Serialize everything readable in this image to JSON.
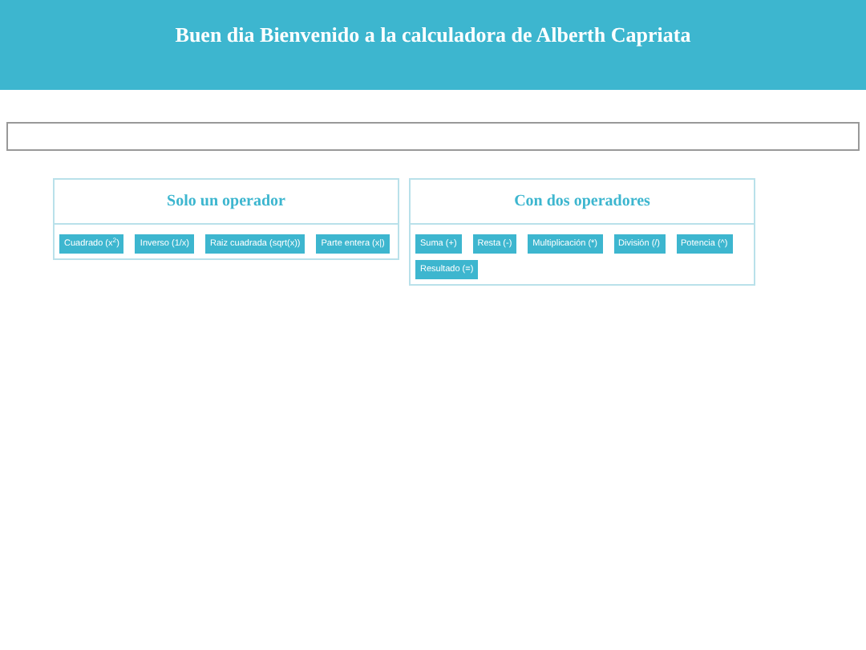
{
  "header": {
    "title": "Buen dia Bienvenido a la calculadora de Alberth Capriata"
  },
  "panels": [
    {
      "title": "Solo un operador",
      "buttons": [
        "Cuadrado (x$^{2}$)",
        "Inverso (1/x)",
        "Raiz cuadrada (sqrt(x))",
        "Parte entera (x|)"
      ]
    },
    {
      "title": "Con dos operadores",
      "buttons": [
        "Suma (+)",
        "Resta (-)",
        "Multiplicación (*)",
        "División (/)",
        "Potencia (^)",
        "Resultado (=)"
      ]
    }
  ]
}
